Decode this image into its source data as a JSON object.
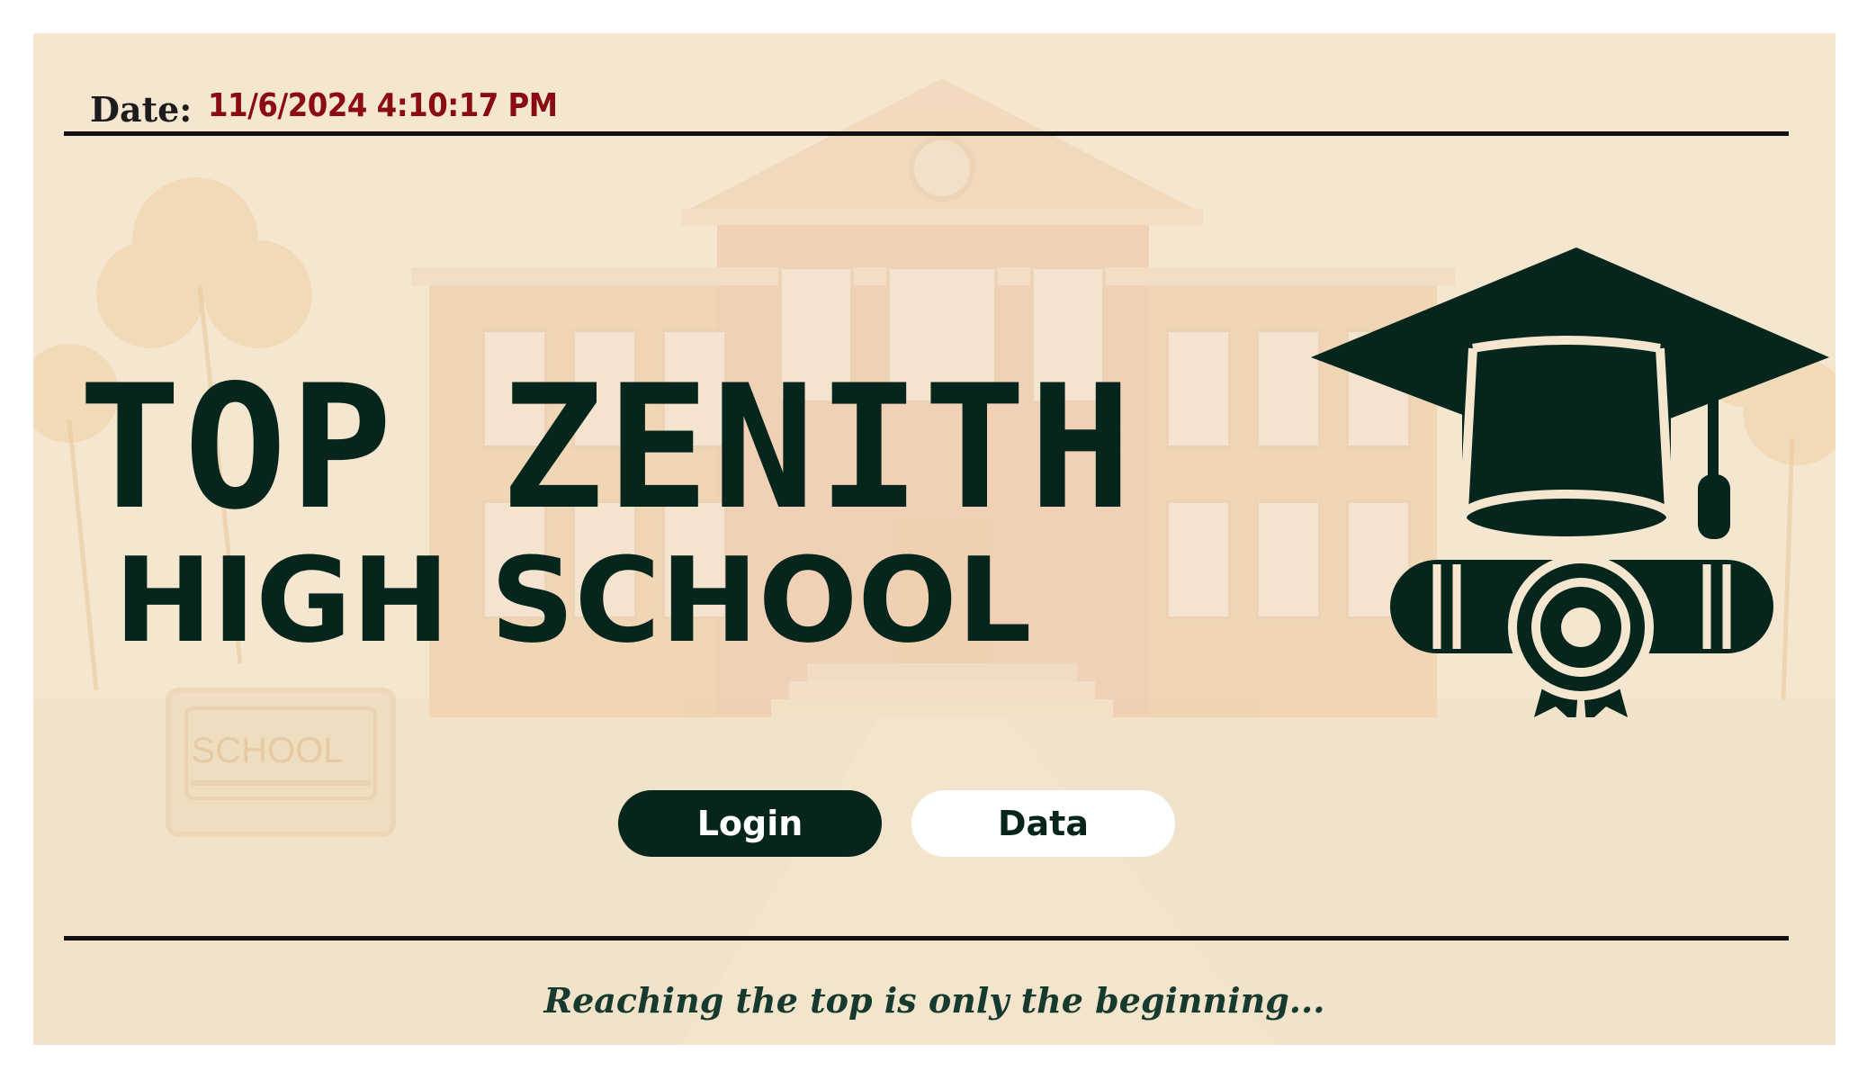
{
  "header": {
    "date_label": "Date:",
    "date_value": "11/6/2024 4:10:17 PM"
  },
  "title": {
    "line1": "TOP ZENITH",
    "line2": "HIGH SCHOOL"
  },
  "background_sign": "SCHOOL",
  "buttons": {
    "login_label": "Login",
    "data_label": "Data"
  },
  "footer": {
    "tagline": "Reaching the top is only the beginning..."
  },
  "icons": {
    "logo": "graduation-cap-diploma-icon"
  },
  "colors": {
    "background": "#f4e6cf",
    "brand_dark": "#06251d",
    "date_red": "#8a0c12",
    "rule": "#111111",
    "button_light": "#ffffff"
  }
}
